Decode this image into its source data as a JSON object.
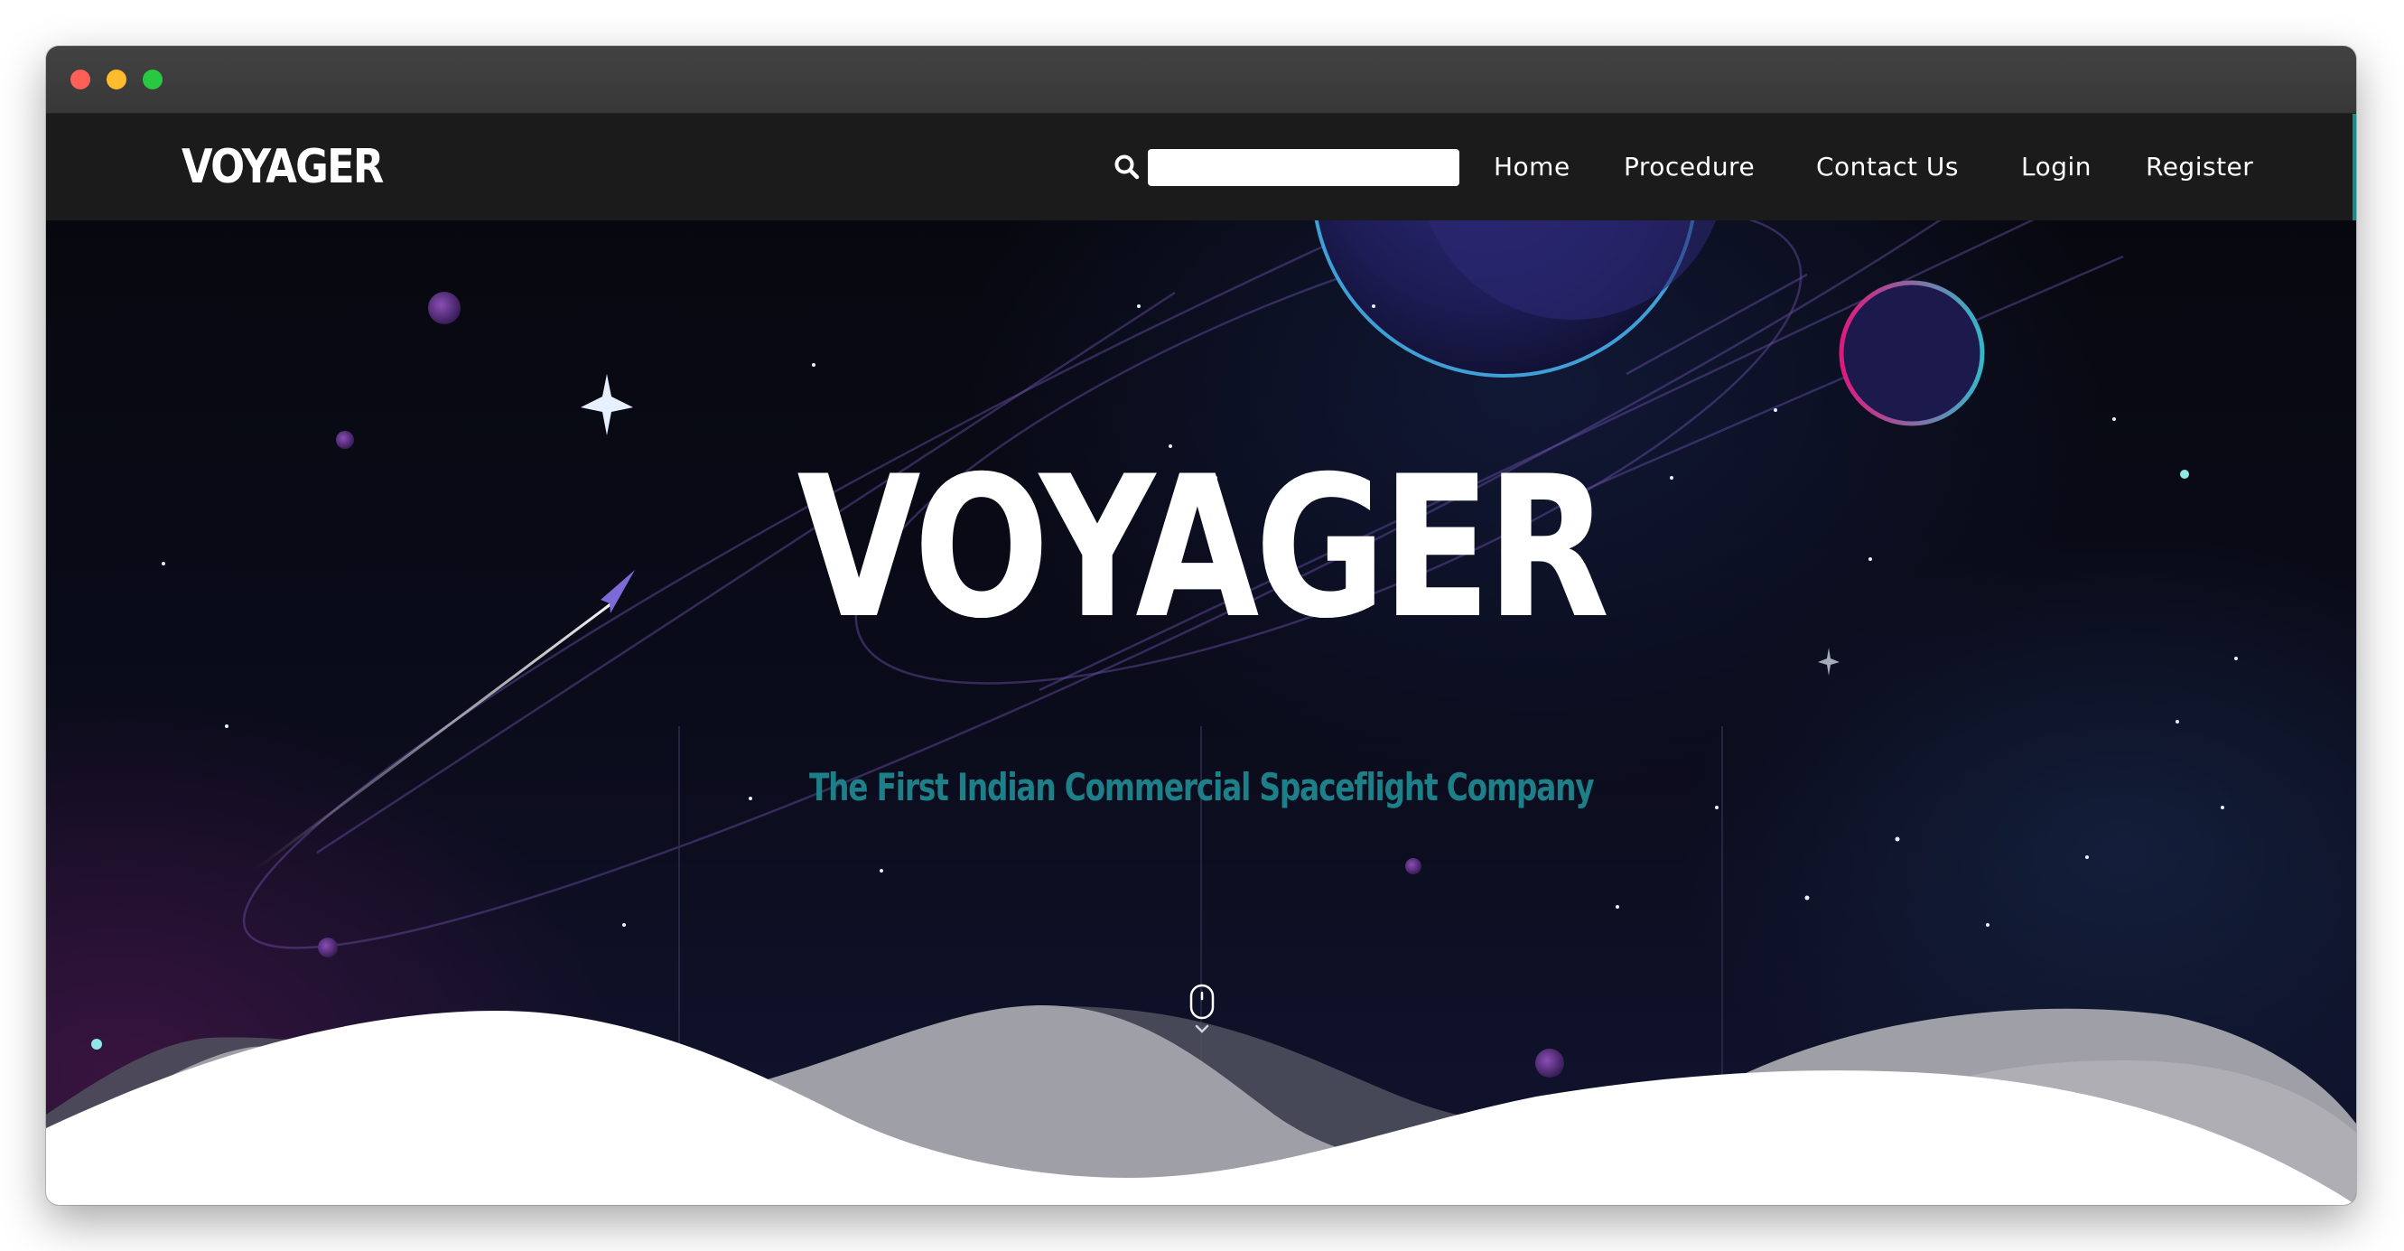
{
  "site": {
    "brand": "VOYAGER"
  },
  "nav": {
    "search_placeholder": "",
    "links": [
      {
        "label": "Home"
      },
      {
        "label": "Procedure"
      },
      {
        "label": "Contact Us"
      },
      {
        "label": "Login"
      },
      {
        "label": "Register"
      }
    ]
  },
  "hero": {
    "title": "VOYAGER",
    "subtitle": "The First Indian Commercial Spaceflight Company"
  },
  "icons": {
    "search": "search-icon",
    "scroll_indicator": "mouse-scroll-icon"
  },
  "colors": {
    "navbar_bg": "#1b1b1b",
    "subtitle": "#1d7f88",
    "accent_scrollbar": "#1d8a8a"
  }
}
